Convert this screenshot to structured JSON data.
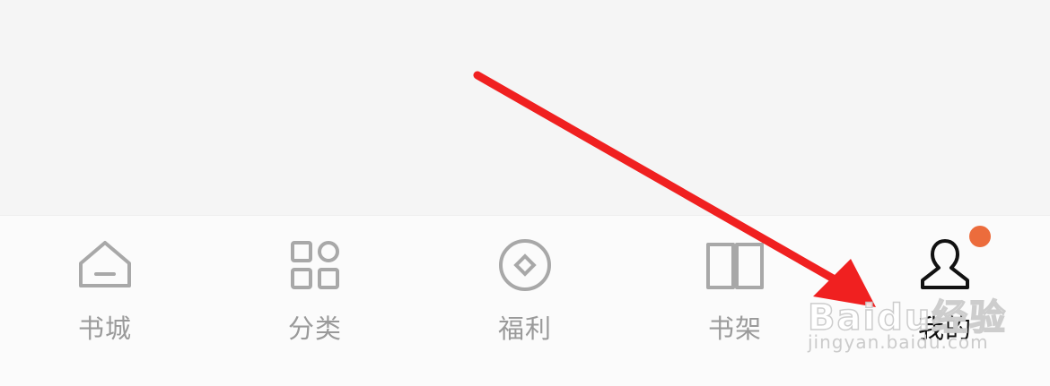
{
  "tab_bar": {
    "tabs": [
      {
        "label": "书城",
        "icon": "home-icon",
        "active": false
      },
      {
        "label": "分类",
        "icon": "category-grid-icon",
        "active": false
      },
      {
        "label": "福利",
        "icon": "coin-icon",
        "active": false
      },
      {
        "label": "书架",
        "icon": "open-book-icon",
        "active": false
      },
      {
        "label": "我的",
        "icon": "user-profile-icon",
        "active": true
      }
    ],
    "badge_color": "#ec6c3c",
    "inactive_color": "#9a9a9a",
    "active_color": "#111111"
  },
  "annotation": {
    "arrow_color": "#f02020"
  },
  "watermark": {
    "brand": "Baidu经验",
    "url": "jingyan.baidu.com"
  }
}
